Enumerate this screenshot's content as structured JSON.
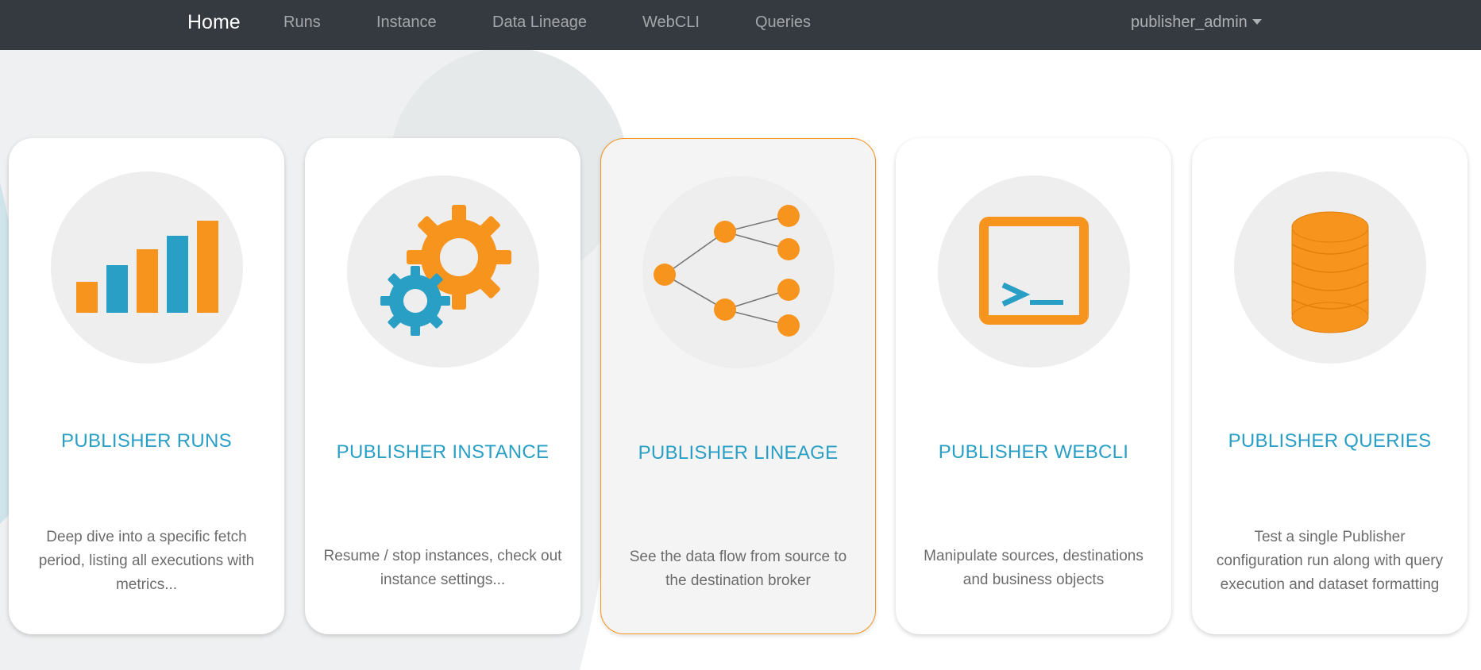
{
  "navbar": {
    "brand": "Home",
    "links": [
      "Runs",
      "Instance",
      "Data Lineage",
      "WebCLI",
      "Queries"
    ],
    "user": "publisher_admin"
  },
  "colors": {
    "navbar_bg": "#343a40",
    "accent_orange": "#f7941d",
    "accent_blue": "#2a9fc5",
    "card_bg": "#ffffff",
    "icon_circle_bg": "#eeeeee"
  },
  "cards": [
    {
      "title": "PUBLISHER RUNS",
      "description": "Deep dive into a specific fetch period, listing all executions with metrics...",
      "icon": "bar-chart-icon"
    },
    {
      "title": "PUBLISHER INSTANCE",
      "description": "Resume / stop instances, check out instance settings...",
      "icon": "gears-icon"
    },
    {
      "title": "PUBLISHER LINEAGE",
      "description": "See the data flow from source to the destination broker",
      "icon": "tree-diagram-icon",
      "highlighted": true
    },
    {
      "title": "PUBLISHER WEBCLI",
      "description": "Manipulate sources, destinations and business objects",
      "icon": "terminal-icon"
    },
    {
      "title": "PUBLISHER QUERIES",
      "description": "Test a single Publisher configuration run along with query execution and dataset formatting",
      "icon": "database-icon"
    }
  ]
}
